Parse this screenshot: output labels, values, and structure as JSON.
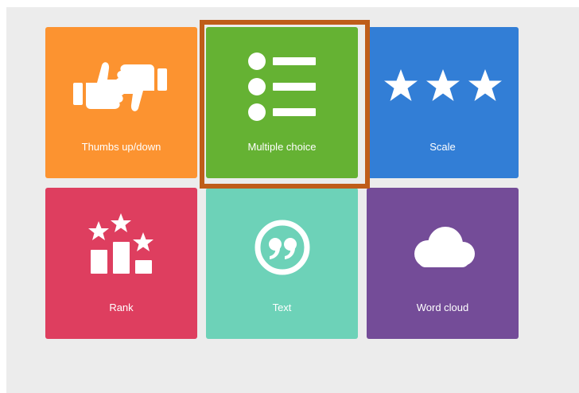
{
  "tiles": [
    {
      "id": "thumbs",
      "label": "Thumbs up/down",
      "color": "#fc9330",
      "icon": "thumbs-up-down-icon"
    },
    {
      "id": "multiple_choice",
      "label": "Multiple choice",
      "color": "#65b233",
      "icon": "list-icon",
      "selected": true
    },
    {
      "id": "scale",
      "label": "Scale",
      "color": "#327ed6",
      "icon": "stars-icon"
    },
    {
      "id": "rank",
      "label": "Rank",
      "color": "#de3e5f",
      "icon": "rank-podium-icon"
    },
    {
      "id": "text",
      "label": "Text",
      "color": "#6dd2b8",
      "icon": "quote-icon"
    },
    {
      "id": "word_cloud",
      "label": "Word cloud",
      "color": "#744c98",
      "icon": "cloud-icon"
    }
  ],
  "selection_border_color": "#bf5d19"
}
